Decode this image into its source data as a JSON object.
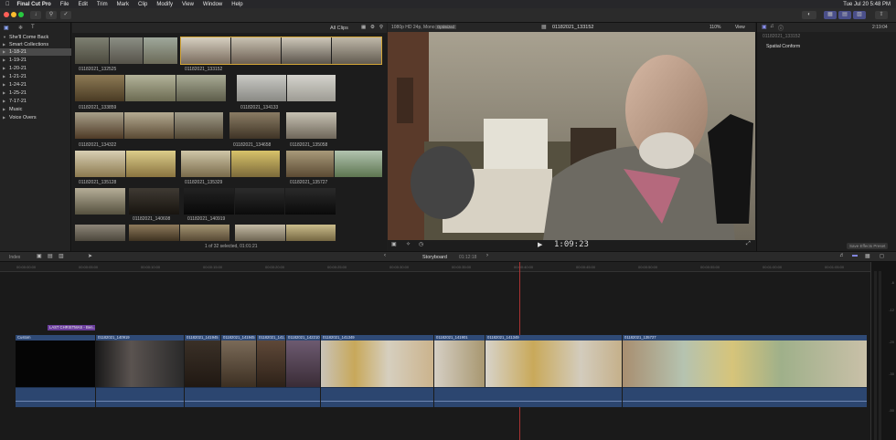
{
  "menubar": {
    "app": "Final Cut Pro",
    "items": [
      "File",
      "Edit",
      "Trim",
      "Mark",
      "Clip",
      "Modify",
      "View",
      "Window",
      "Help"
    ],
    "datetime": "Tue Jul 20  5:48 PM"
  },
  "sidebar": {
    "library": "She'll Come Back",
    "smart": "Smart Collections",
    "events": [
      "1-18-21",
      "1-19-21",
      "1-20-21",
      "1-21-21",
      "1-24-21",
      "1-25-21",
      "7-17-21",
      "Music",
      "Voice Overs"
    ]
  },
  "browser": {
    "filter": "All Clips",
    "clips": [
      "01182021_132525",
      "01182021_133152",
      "01182021_133859",
      "01182021_134133",
      "01182021_134322",
      "01182021_134658",
      "01182021_135058",
      "01182021_135128",
      "01182021_135329",
      "01182021_135727",
      "01182021_140608",
      "01182021_140919"
    ],
    "status": "1 of 32 selected, 01:01:21"
  },
  "viewer": {
    "format": "1080p HD 24p, Mono",
    "badge": "Optimized",
    "clip": "01182021_133152",
    "zoom": "110%",
    "view": "View",
    "timecode": "1:09:23"
  },
  "inspector": {
    "duration": "2:19:04",
    "filename": "01182021_133152",
    "section": "Spatial Conform",
    "save_button": "Save Effects Preset"
  },
  "timeline": {
    "index": "Index",
    "project": "Storyboard",
    "duration": "01:12:18",
    "ticks": [
      "00:00:00:00",
      "00:00:05:00",
      "00:00:10:00",
      "00:00:15:00",
      "00:00:20:00",
      "00:00:25:00",
      "00:00:30:00",
      "00:00:35:00",
      "00:00:40:00",
      "00:00:45:00",
      "00:00:50:00",
      "00:00:55:00",
      "00:01:00:00",
      "00:01:05:00"
    ],
    "title_clip": "LAST CHRISTMAS - Ben...",
    "clips": [
      "Custom",
      "01182021_140919",
      "01182021_141945",
      "01182021_141945",
      "01182021_141...",
      "01182021_142210",
      "01182021_141349",
      "01182021_141901",
      "01182021_141349",
      "01182021_135727"
    ],
    "meter_labels": [
      "-6",
      "-12",
      "-20",
      "-30",
      "-50"
    ]
  }
}
